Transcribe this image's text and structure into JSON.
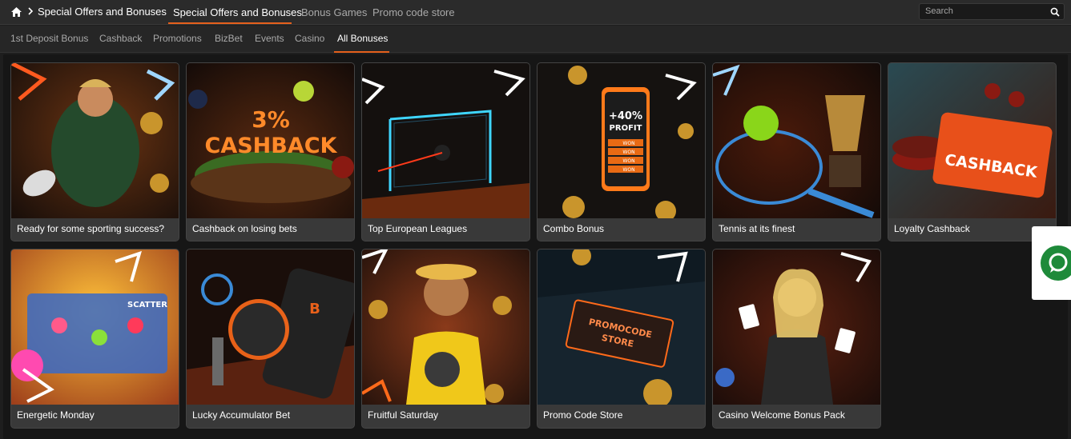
{
  "header": {
    "breadcrumb": "Special Offers and Bonuses",
    "tabs": [
      {
        "label": "Special Offers and Bonuses",
        "active": true
      },
      {
        "label": "Bonus Games",
        "active": false
      },
      {
        "label": "Promo code store",
        "active": false
      }
    ],
    "search": {
      "placeholder": "Search",
      "icon": "search-icon"
    }
  },
  "subnav": {
    "items": [
      {
        "label": "1st Deposit Bonus",
        "active": false
      },
      {
        "label": "Cashback",
        "active": false
      },
      {
        "label": "Promotions",
        "active": false
      },
      {
        "label": "BizBet",
        "active": false
      },
      {
        "label": "Events",
        "active": false
      },
      {
        "label": "Casino",
        "active": false
      },
      {
        "label": "All Bonuses",
        "active": true
      }
    ]
  },
  "cards": [
    {
      "title": "Ready for some sporting success?",
      "art_text": ""
    },
    {
      "title": "Cashback on losing bets",
      "art_text": "3%",
      "art_text2": "CASHBACK"
    },
    {
      "title": "Top European Leagues",
      "art_text": ""
    },
    {
      "title": "Combo Bonus",
      "art_text": "+40%",
      "art_text2": "PROFIT",
      "art_rows": [
        "WON",
        "WON",
        "WON",
        "WON"
      ]
    },
    {
      "title": "Tennis at its finest",
      "art_text": ""
    },
    {
      "title": "Loyalty Cashback",
      "art_text": "CASHBACK"
    },
    {
      "title": "Energetic Monday",
      "art_text": "SCATTER"
    },
    {
      "title": "Lucky Accumulator Bet",
      "art_text": ""
    },
    {
      "title": "Fruitful Saturday",
      "art_text": ""
    },
    {
      "title": "Promo Code Store",
      "art_text": "PROMOCODE",
      "art_text2": "STORE"
    },
    {
      "title": "Casino Welcome Bonus Pack",
      "art_text": ""
    }
  ],
  "colors": {
    "accent": "#e5601c",
    "chat": "#1e8a3a"
  },
  "chat": {
    "icon": "chat-bubble-icon"
  }
}
